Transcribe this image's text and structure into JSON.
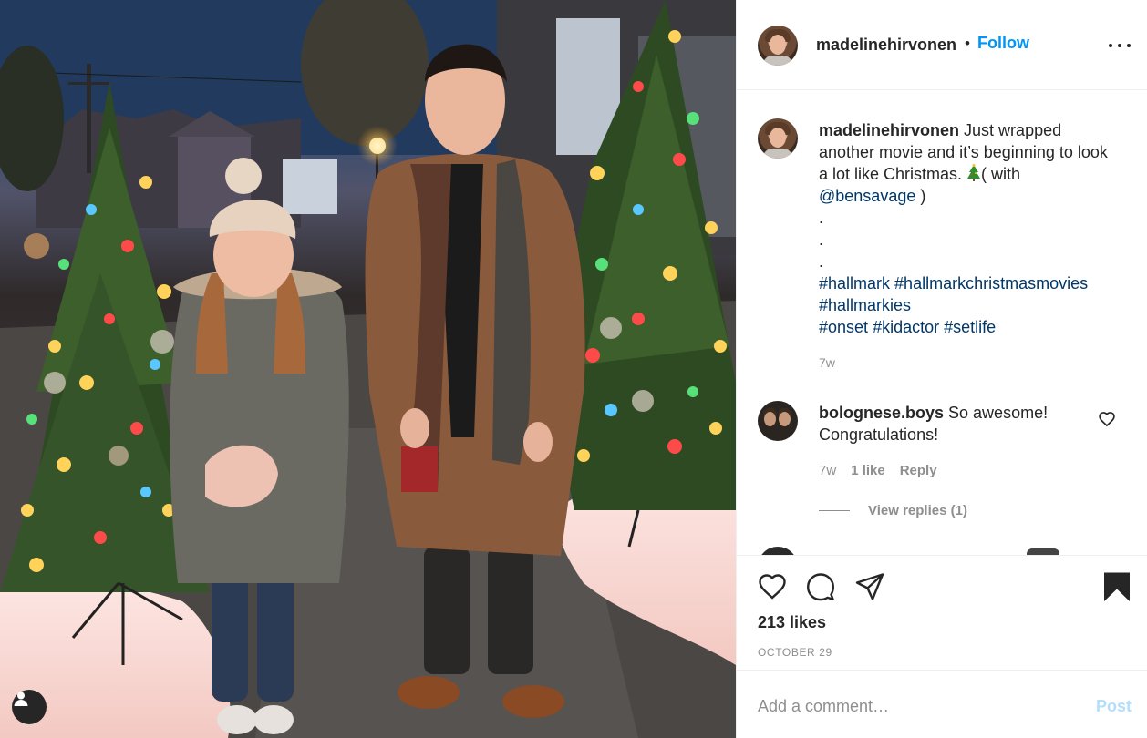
{
  "post": {
    "author": "madelinehirvonen",
    "follow_label": "Follow",
    "dot": "•",
    "more_icon": "more-options-icon",
    "user_tag_icon": "user-tag-icon"
  },
  "caption": {
    "username": "madelinehirvonen",
    "text_line1": " Just wrapped another movie and it’s beginning to look a lot like Christmas. ",
    "tree_icon": "christmas-tree-icon",
    "with_text": "( with ",
    "mention": "@bensavage",
    "close_paren": " )",
    "dots": [
      ".",
      ".",
      "."
    ],
    "hashtags_line1": [
      "#hallmark",
      "#hallmarkchristmasmovies"
    ],
    "hashtags_line2": [
      "#hallmarkies"
    ],
    "hashtags_line3": [
      "#onset",
      "#kidactor",
      "#setlife"
    ],
    "time": "7w"
  },
  "comment": {
    "username": "bolognese.boys",
    "text": " So awesome! Congratulations!",
    "time": "7w",
    "likes": "1 like",
    "reply_label": "Reply",
    "view_replies": "View replies (1)"
  },
  "actions": {
    "like_icon": "heart-icon",
    "comment_icon": "comment-icon",
    "share_icon": "share-icon",
    "save_icon": "bookmark-icon",
    "likes_count": "213 likes",
    "date": "OCTOBER 29"
  },
  "add_comment": {
    "placeholder": "Add a comment…",
    "post_label": "Post"
  },
  "colors": {
    "accent": "#0095f6",
    "link": "#00376b",
    "muted": "#8e8e8e",
    "post_disabled": "#b2dffc"
  }
}
